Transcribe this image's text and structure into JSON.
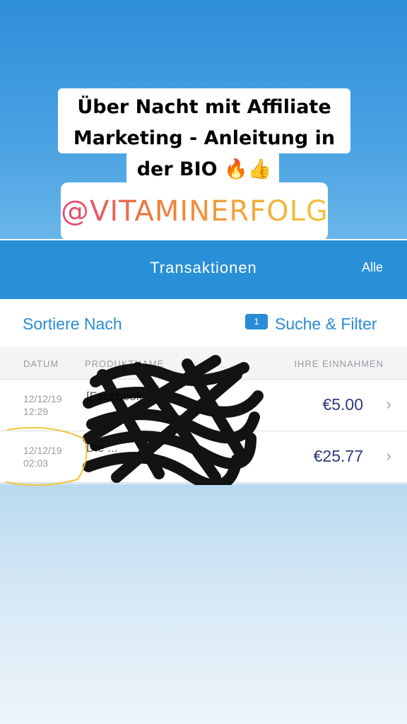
{
  "overlay": {
    "line1": "Über Nacht mit Affiliate",
    "line2": "Marketing - Anleitung in",
    "line3": "der BIO 🔥👍",
    "handle": "@VITAMINERFOLG"
  },
  "navbar": {
    "title": "Transaktionen",
    "right_label": "Alle"
  },
  "toolbar": {
    "sort_label": "Sortiere Nach",
    "filter_count": "1",
    "filter_label": "Suche & Filter"
  },
  "table": {
    "headers": {
      "date": "DATUM",
      "product": "PRODUKTNAME",
      "earnings": "IHRE EINNAHMEN"
    },
    "rows": [
      {
        "date": "12/12/19",
        "time": "12:29",
        "product": "[Facebook...",
        "amount": "€5.00"
      },
      {
        "date": "12/12/19",
        "time": "02:03",
        "product": "Die ...",
        "amount": "€25.77"
      }
    ]
  },
  "colors": {
    "accent": "#2a8cd6",
    "navbar": "#2990d8",
    "amount": "#2f3a7a",
    "highlight_circle": "#f2c43a"
  }
}
